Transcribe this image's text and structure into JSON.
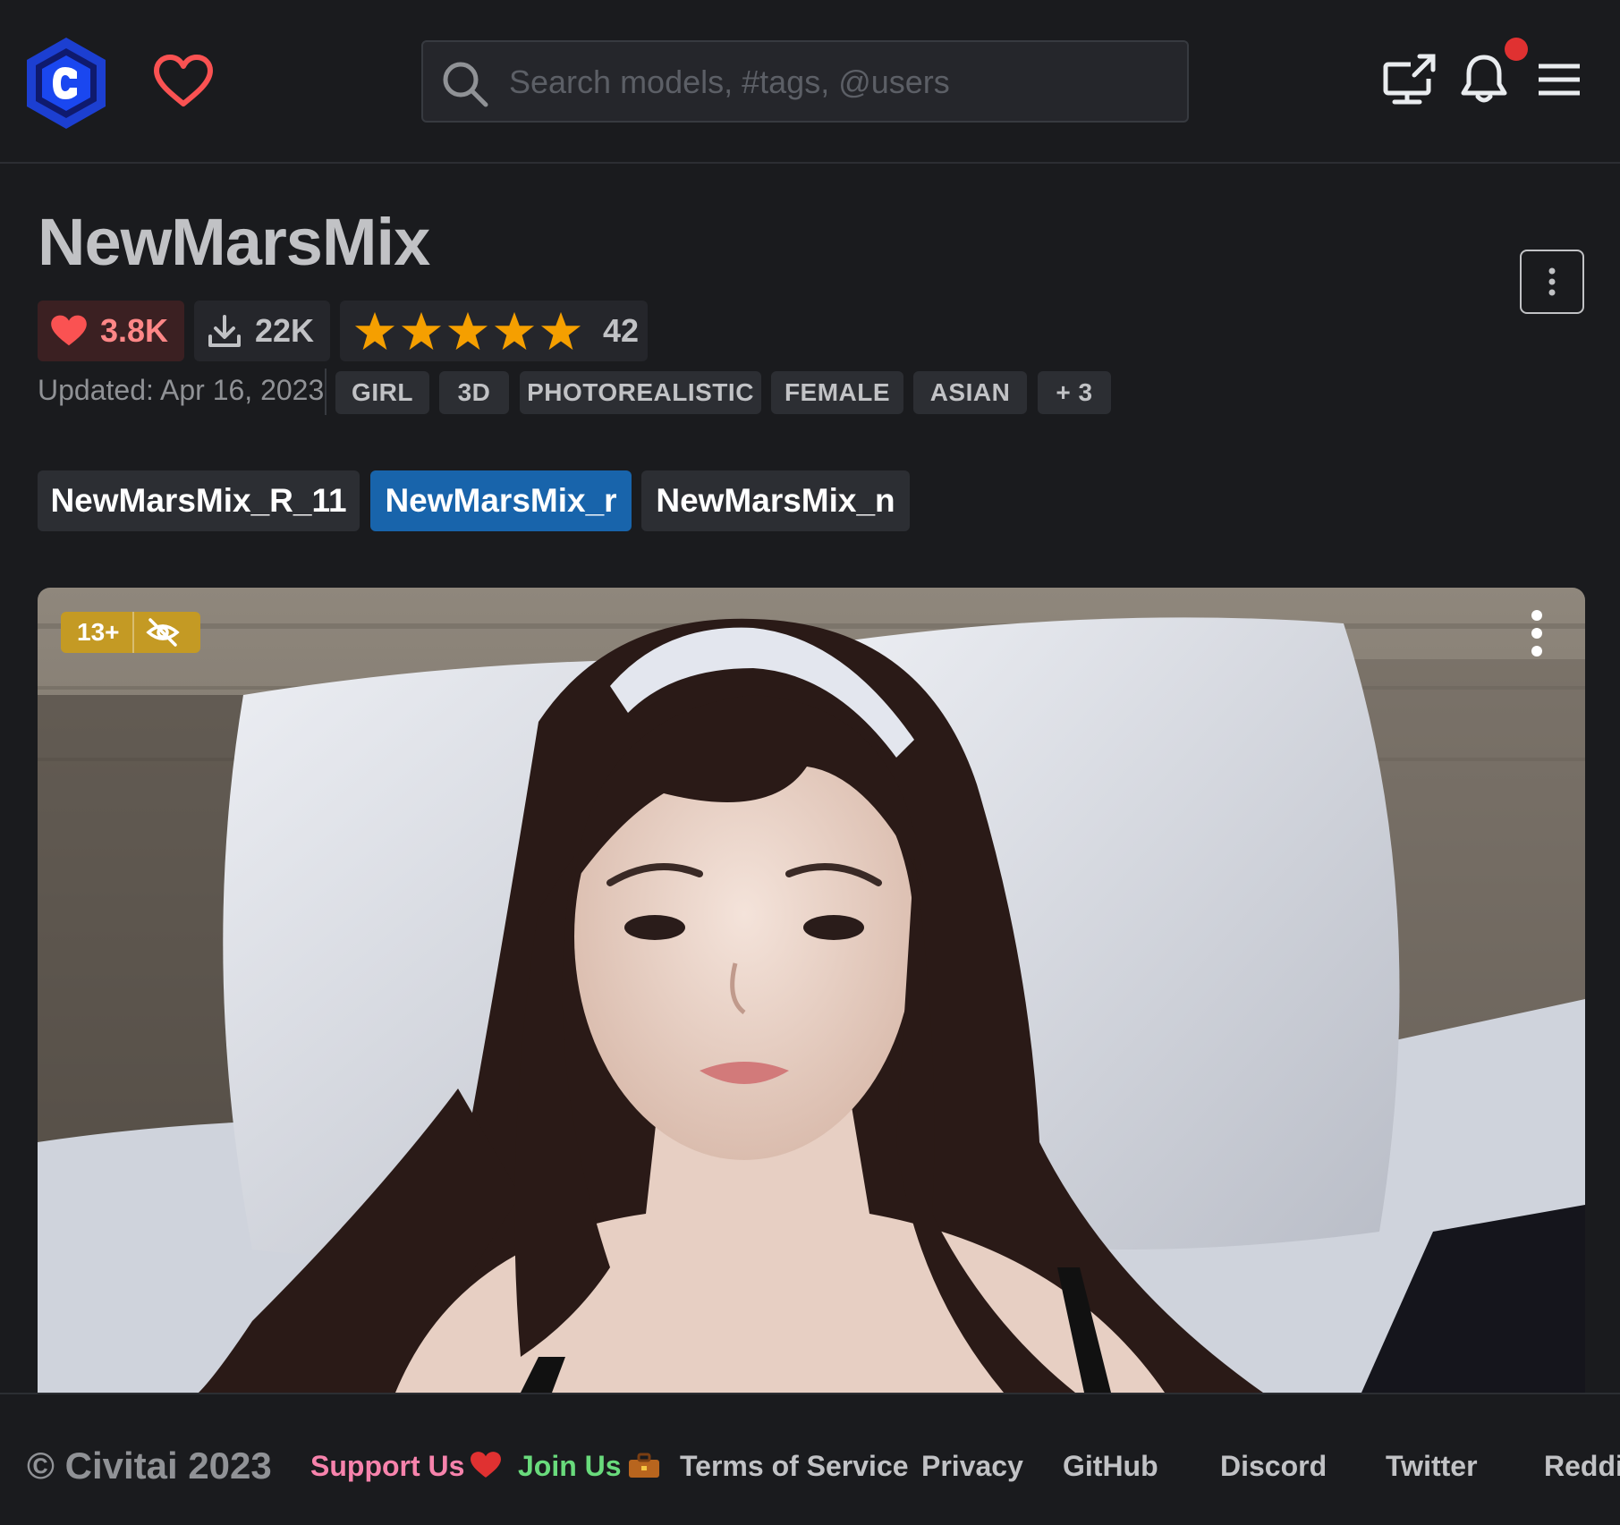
{
  "header": {
    "search_placeholder": "Search models, #tags, @users",
    "icons": [
      "civitai-logo",
      "heart-icon",
      "search-icon",
      "monitor-upload-icon",
      "bell-icon",
      "menu-icon"
    ]
  },
  "model": {
    "title": "NewMarsMix",
    "likes": "3.8K",
    "downloads": "22K",
    "rating_count": "42",
    "rating_stars": 5,
    "updated": "Updated: Apr 16, 2023",
    "tags": [
      "GIRL",
      "3D",
      "PHOTOREALISTIC",
      "FEMALE",
      "ASIAN",
      "+ 3"
    ],
    "versions": [
      {
        "label": "NewMarsMix_R_11",
        "active": false
      },
      {
        "label": "NewMarsMix_r",
        "active": true
      },
      {
        "label": "NewMarsMix_n",
        "active": false
      }
    ]
  },
  "image": {
    "rating_badge": "13+"
  },
  "footer": {
    "copyright": "© Civitai 2023",
    "links": [
      "Support Us",
      "Join Us",
      "Terms of Service",
      "Privacy",
      "GitHub",
      "Discord",
      "Twitter",
      "Reddit"
    ]
  },
  "colors": {
    "background": "#1a1b1e",
    "accent": "#1864ab",
    "like": "#fa5252",
    "star": "#f59f00",
    "badge": "#c49a24",
    "notification": "#e03131"
  }
}
